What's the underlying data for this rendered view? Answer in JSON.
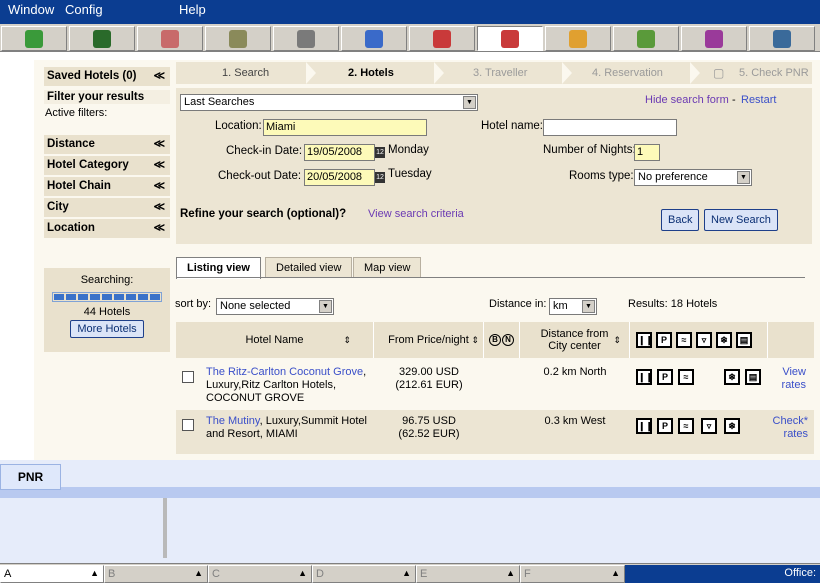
{
  "menubar": {
    "window": "Window",
    "config": "Config",
    "help": "Help"
  },
  "toolbar": {
    "icons": [
      "module-icon",
      "terminal-icon",
      "customer-icon",
      "flight-icon",
      "air-icon",
      "car-icon",
      "hotel-icon",
      "hotel-plus-icon",
      "umbrella-icon",
      "money-icon",
      "ticket-icon",
      "document-icon"
    ],
    "colors": [
      "#3a9a3a",
      "#2a6a2a",
      "#c86a6a",
      "#8a8a5a",
      "#7a7a7a",
      "#3a6ac9",
      "#c93a3a",
      "#c93a3a",
      "#e0a030",
      "#5a9a3a",
      "#9a3a9a",
      "#3a6a9a"
    ]
  },
  "sidebar": {
    "saved_hotels": "Saved Hotels (0)",
    "filter_title": "Filter your results",
    "active_filters": "Active filters:",
    "filters": [
      "Distance",
      "Hotel Category",
      "Hotel Chain",
      "City",
      "Location"
    ],
    "searching_label": "Searching:",
    "hotel_count": "44 Hotels",
    "more_hotels": "More Hotels",
    "progress": 1.0
  },
  "steps": [
    "1. Search",
    "2. Hotels",
    "3. Traveller",
    "4. Reservation",
    "5. Check PNR"
  ],
  "form": {
    "last_searches": "Last Searches",
    "hide_link": "Hide search form",
    "sep": "-",
    "restart_link": "Restart",
    "location_label": "Location:",
    "location_value": "Miami",
    "checkin_label": "Check-in Date:",
    "checkin_value": "19/05/2008",
    "checkin_day": "Monday",
    "checkout_label": "Check-out Date:",
    "checkout_value": "20/05/2008",
    "checkout_day": "Tuesday",
    "hotel_name_label": "Hotel name:",
    "hotel_name_value": "",
    "nights_label": "Number of Nights:",
    "nights_value": "1",
    "rooms_label": "Rooms type:",
    "rooms_value": "No preference",
    "refine_label": "Refine your search (optional)?",
    "view_criteria": "View search criteria",
    "back_btn": "Back",
    "new_search_btn": "New Search"
  },
  "tabs": [
    "Listing view",
    "Detailed view",
    "Map view"
  ],
  "list": {
    "sort_label": "sort by:",
    "sort_value": "None selected",
    "distance_label": "Distance in:",
    "distance_value": "km",
    "results": "Results: 18 Hotels",
    "headers": {
      "hotel_name": "Hotel Name",
      "price": "From Price/night",
      "distance": "Distance from City center",
      "b": "B",
      "n": "N"
    },
    "rows": [
      {
        "name": "The Ritz-Carlton Coconut Grove",
        "details": ", Luxury,Ritz Carlton Hotels, COCONUT GROVE",
        "price_usd": "329.00 USD",
        "price_eur": "(212.61 EUR)",
        "distance": "0.2 km North",
        "action1": "View",
        "action2": "rates"
      },
      {
        "name": "The Mutiny",
        "details": ", Luxury,Summit Hotel and Resort, MIAMI",
        "price_usd": "96.75 USD",
        "price_eur": "(62.52 EUR)",
        "distance": "0.3 km West",
        "action1": "Check*",
        "action2": "rates"
      }
    ]
  },
  "pnr": {
    "tab": "PNR"
  },
  "statusbar": {
    "cells": [
      "A",
      "B",
      "C",
      "D",
      "E",
      "F"
    ],
    "office": "Office:"
  }
}
